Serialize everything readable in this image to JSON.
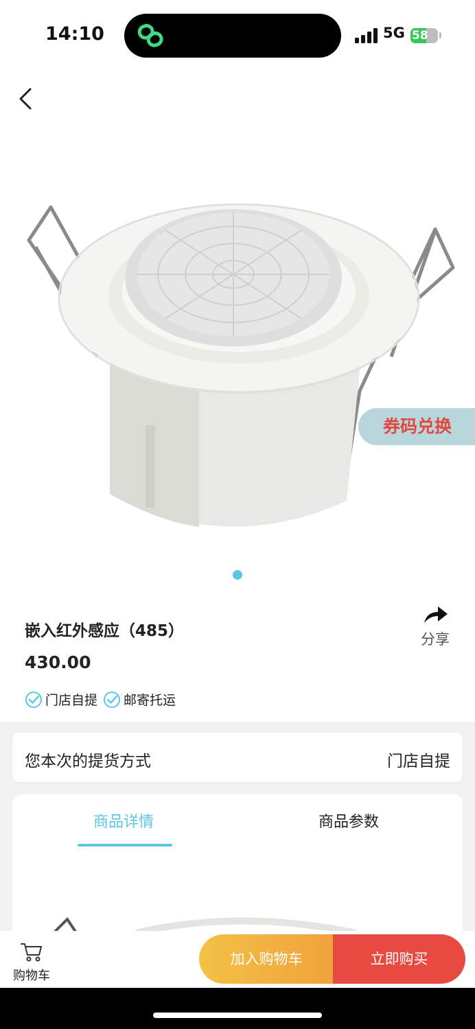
{
  "status_bar": {
    "time": "14:10",
    "network": "5G",
    "battery": "58",
    "battery_level": 0.58,
    "island_icon": "link-icon"
  },
  "nav": {
    "back_icon": "chevron-left-icon"
  },
  "product": {
    "title": "嵌入红外感应（485）",
    "price": "430.00",
    "image_count": 1,
    "active_image": 1,
    "tags": [
      "门店自提",
      "邮寄托运"
    ]
  },
  "coupon_label": "券码兑换",
  "share_label": "分享",
  "pickup": {
    "label": "您本次的提货方式",
    "value": "门店自提"
  },
  "tabs": [
    {
      "label": "商品详情",
      "active": true
    },
    {
      "label": "商品参数",
      "active": false
    }
  ],
  "bottom_bar": {
    "cart_label": "购物车",
    "add_to_cart": "加入购物车",
    "buy_now": "立即购买"
  },
  "colors": {
    "accent": "#5bc6e8",
    "buy": "#e94a3f",
    "add_cart_start": "#f3c246",
    "add_cart_end": "#f0a23b",
    "coupon_bg": "#b9d6dc",
    "coupon_text": "#e0483e"
  }
}
